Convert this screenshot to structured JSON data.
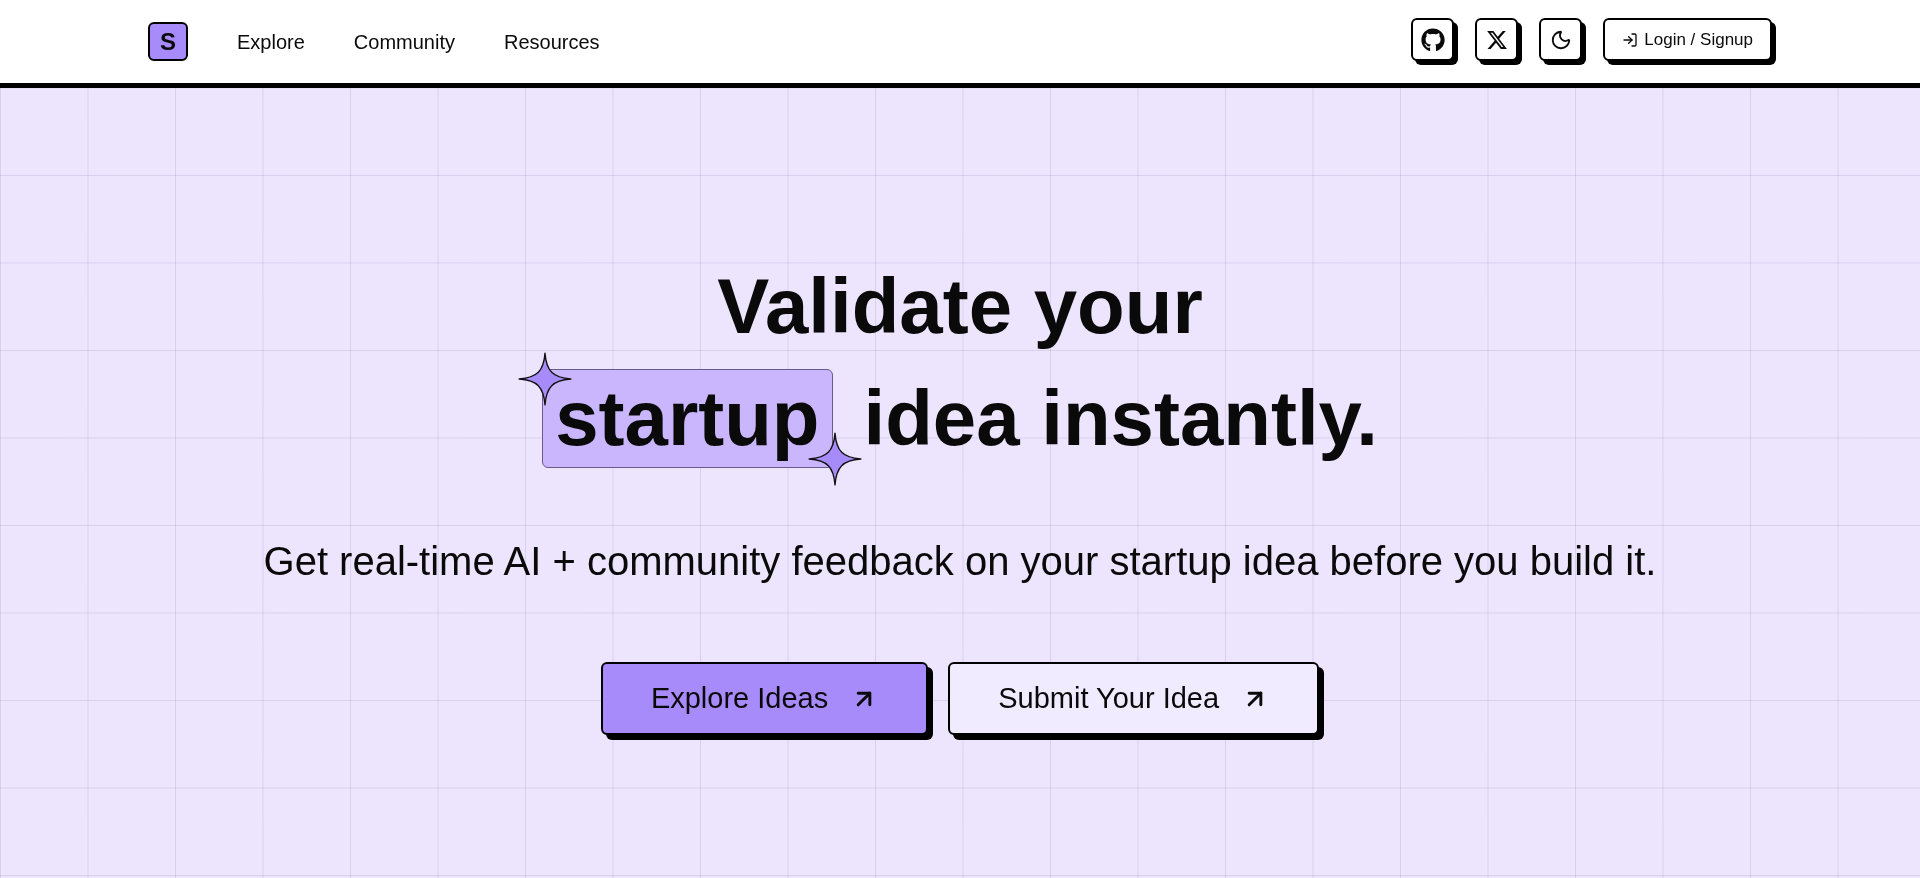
{
  "header": {
    "logo": "S",
    "nav": [
      {
        "label": "Explore"
      },
      {
        "label": "Community"
      },
      {
        "label": "Resources"
      }
    ],
    "login_button": {
      "label": "Login / Signup"
    }
  },
  "hero": {
    "headline": {
      "line_1": "Validate your",
      "highlight": "startup",
      "line_2_rest": "idea instantly."
    },
    "subtitle": "Get real-time AI + community feedback on your startup idea before you build it.",
    "buttons": [
      {
        "label": "Explore Ideas",
        "kind": "primary"
      },
      {
        "label": "Submit Your Idea",
        "kind": "secondary"
      }
    ]
  }
}
